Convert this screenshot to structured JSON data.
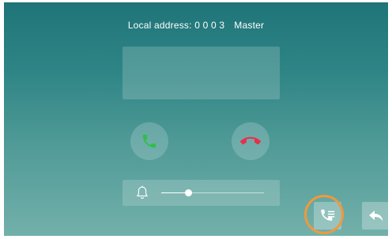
{
  "header": {
    "address_label": "Local address: 0 0 0 3",
    "role": "Master"
  },
  "call_controls": {
    "answer_icon": "phone-answer-icon",
    "hangup_icon": "phone-hangup-icon",
    "answer_color": "#2fbf4a",
    "hangup_color": "#e8304a"
  },
  "volume": {
    "icon": "bell-icon",
    "level": 0.26
  },
  "bottom_bar": {
    "call_list_icon": "call-list-icon",
    "back_icon": "back-arrow-icon"
  },
  "colors": {
    "highlight_ring": "#ee9a3e"
  }
}
